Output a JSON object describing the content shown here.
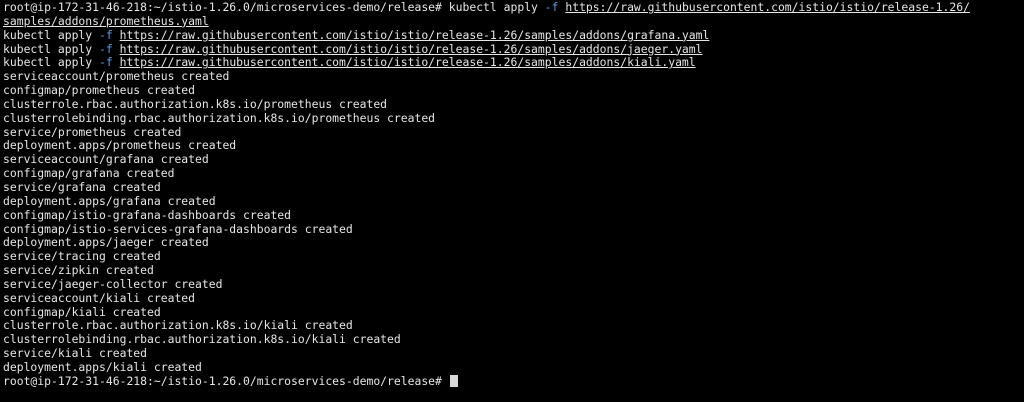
{
  "terminal": {
    "prompt": "root@ip-172-31-46-218:~/istio-1.26.0/microservices-demo/release#",
    "cmd": "kubectl apply",
    "flag": "-f",
    "urls": {
      "prometheus_part1": "https://raw.githubusercontent.com/istio/istio/release-1.26/",
      "prometheus_part2": "samples/addons/prometheus.yaml",
      "grafana": "https://raw.githubusercontent.com/istio/istio/release-1.26/samples/addons/grafana.yaml",
      "jaeger": "https://raw.githubusercontent.com/istio/istio/release-1.26/samples/addons/jaeger.yaml",
      "kiali": "https://raw.githubusercontent.com/istio/istio/release-1.26/samples/addons/kiali.yaml"
    },
    "output": [
      "serviceaccount/prometheus created",
      "configmap/prometheus created",
      "clusterrole.rbac.authorization.k8s.io/prometheus created",
      "clusterrolebinding.rbac.authorization.k8s.io/prometheus created",
      "service/prometheus created",
      "deployment.apps/prometheus created",
      "serviceaccount/grafana created",
      "configmap/grafana created",
      "service/grafana created",
      "deployment.apps/grafana created",
      "configmap/istio-grafana-dashboards created",
      "configmap/istio-services-grafana-dashboards created",
      "deployment.apps/jaeger created",
      "service/tracing created",
      "service/zipkin created",
      "service/jaeger-collector created",
      "serviceaccount/kiali created",
      "configmap/kiali created",
      "clusterrole.rbac.authorization.k8s.io/kiali created",
      "clusterrolebinding.rbac.authorization.k8s.io/kiali created",
      "service/kiali created",
      "deployment.apps/kiali created"
    ]
  },
  "colors": {
    "background": "#000000",
    "text": "#e6e6e6",
    "flag": "#5e9bd8"
  }
}
